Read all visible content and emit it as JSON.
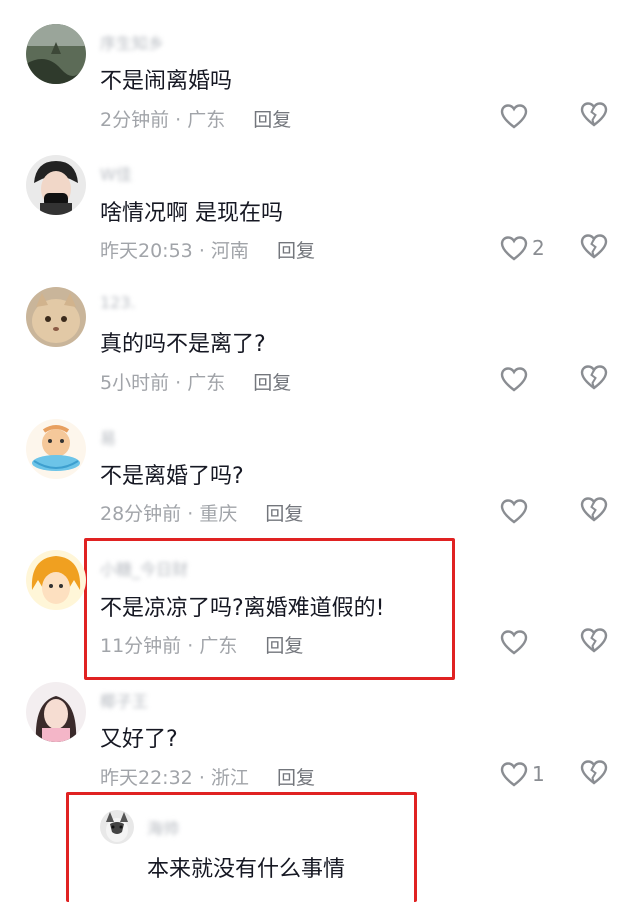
{
  "comments": [
    {
      "name": "序生知乡",
      "text": "不是闹离婚吗",
      "time": "2分钟前",
      "location": "广东",
      "reply": "回复",
      "likes": ""
    },
    {
      "name": "W佳",
      "text": "啥情况啊  是现在吗",
      "time": "昨天20:53",
      "location": "河南",
      "reply": "回复",
      "likes": "2"
    },
    {
      "name": "123.",
      "text": "真的吗不是离了?",
      "time": "5小时前",
      "location": "广东",
      "reply": "回复",
      "likes": ""
    },
    {
      "name": "易",
      "text": "不是离婚了吗?",
      "time": "28分钟前",
      "location": "重庆",
      "reply": "回复",
      "likes": ""
    },
    {
      "name": "小糖_今日财",
      "text": "不是凉凉了吗?离婚难道假的!",
      "time": "11分钟前",
      "location": "广东",
      "reply": "回复",
      "likes": ""
    },
    {
      "name": "椰子王",
      "text": "又好了?",
      "time": "昨天22:32",
      "location": "浙江",
      "reply": "回复",
      "likes": "1"
    }
  ],
  "sub_reply": {
    "name": "海帅",
    "text": "本来就没有什么事情"
  },
  "separator": "·",
  "colors": {
    "highlight": "#e02222",
    "text": "#161823",
    "meta": "#a1a4a9"
  },
  "icons": {
    "like": "heart-outline-icon",
    "dislike": "broken-heart-icon"
  }
}
